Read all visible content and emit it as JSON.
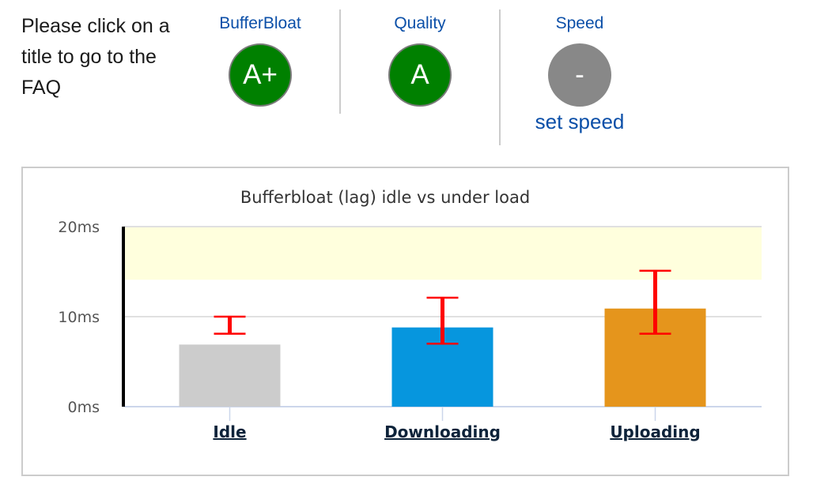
{
  "header": {
    "intro_text": "Please click on a title to go to the FAQ",
    "columns": [
      {
        "title": "BufferBloat",
        "grade": "A+",
        "grade_color": "#008000"
      },
      {
        "title": "Quality",
        "grade": "A",
        "grade_color": "#008000"
      },
      {
        "title": "Speed",
        "grade": "-",
        "grade_color": "#888888",
        "action_link": "set speed"
      }
    ]
  },
  "chart_data": {
    "type": "bar",
    "title": "Bufferbloat (lag) idle vs under load",
    "xlabel": "",
    "ylabel": "",
    "categories": [
      "Idle",
      "Downloading",
      "Uploading"
    ],
    "values": [
      6.9,
      8.8,
      10.9
    ],
    "error_bars": [
      {
        "low": 8.1,
        "high": 10.0
      },
      {
        "low": 7.0,
        "high": 12.1
      },
      {
        "low": 8.1,
        "high": 15.1
      }
    ],
    "bar_colors": [
      "#cccccc",
      "#0696de",
      "#e5951c"
    ],
    "error_bar_color": "#ff0000",
    "highlight_band": {
      "from": 14.1,
      "to": 20,
      "color": "#ffffdd"
    },
    "ylim": [
      0,
      20
    ],
    "yticks": [
      0,
      10,
      20
    ],
    "ytick_labels": [
      "0ms",
      "10ms",
      "20ms"
    ],
    "grid": true,
    "legend": "none"
  }
}
